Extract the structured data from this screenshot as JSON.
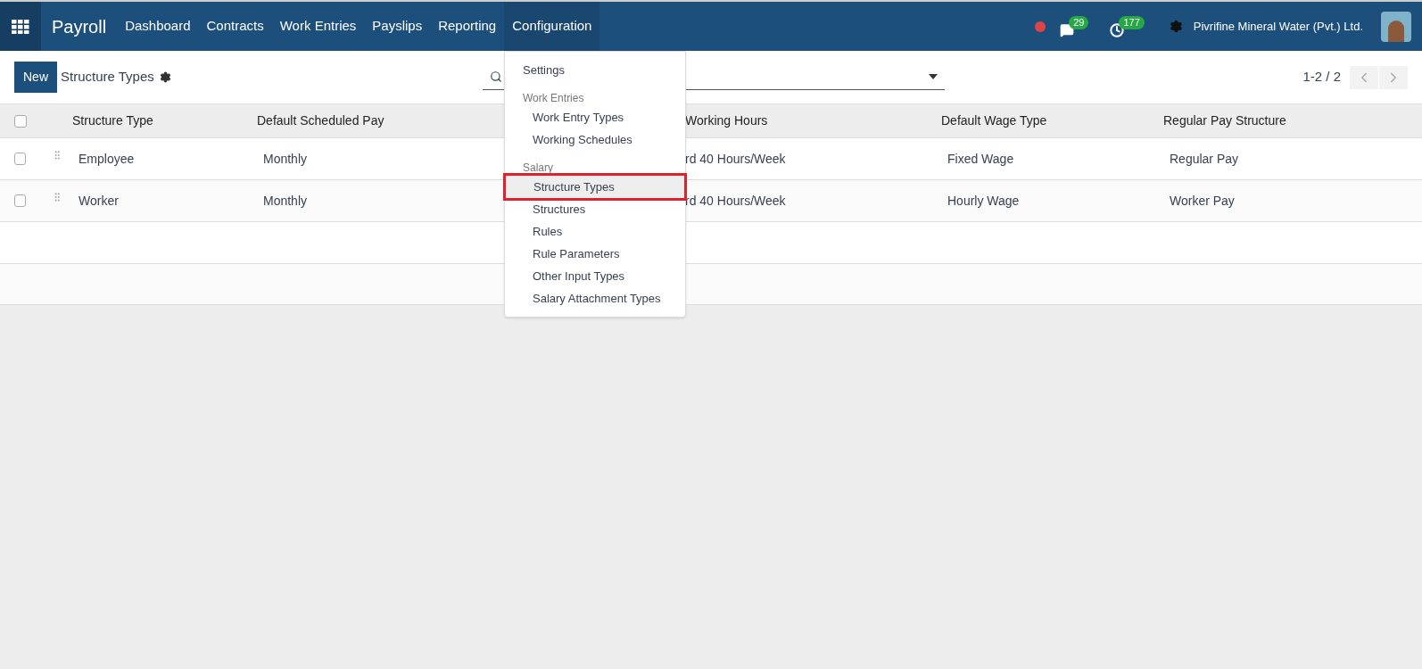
{
  "navbar": {
    "app": "Payroll",
    "menu": [
      {
        "label": "Dashboard",
        "selected": false
      },
      {
        "label": "Contracts",
        "selected": false
      },
      {
        "label": "Work Entries",
        "selected": false
      },
      {
        "label": "Payslips",
        "selected": false
      },
      {
        "label": "Reporting",
        "selected": false
      },
      {
        "label": "Configuration",
        "selected": true
      }
    ],
    "messages_count": "29",
    "activities_count": "177",
    "company": "Pivrifine Mineral Water (Pvt.) Ltd."
  },
  "control_panel": {
    "new_button": "New",
    "breadcrumb": "Structure Types",
    "pager": "1-2 / 2"
  },
  "table": {
    "select_all_checked": false,
    "columns": [
      "Structure Type",
      "Default Scheduled Pay",
      "Working Hours",
      "Default Wage Type",
      "Regular Pay Structure"
    ],
    "rows": [
      {
        "checked": false,
        "cells": [
          "Employee",
          "Monthly",
          "rd 40 Hours/Week",
          "Fixed Wage",
          "Regular Pay"
        ]
      },
      {
        "checked": false,
        "cells": [
          "Worker",
          "Monthly",
          "rd 40 Hours/Week",
          "Hourly Wage",
          "Worker Pay"
        ]
      }
    ]
  },
  "dropdown": {
    "sections": [
      {
        "items": [
          {
            "label": "Settings",
            "selected": false
          }
        ]
      },
      {
        "header": "Work Entries",
        "items": [
          {
            "label": "Work Entry Types",
            "selected": false
          },
          {
            "label": "Working Schedules",
            "selected": false
          }
        ]
      },
      {
        "header": "Salary",
        "items": [
          {
            "label": "Structure Types",
            "selected": true
          },
          {
            "label": "Structures",
            "selected": false
          },
          {
            "label": "Rules",
            "selected": false
          },
          {
            "label": "Rule Parameters",
            "selected": false
          },
          {
            "label": "Other Input Types",
            "selected": false
          },
          {
            "label": "Salary Attachment Types",
            "selected": false
          }
        ]
      }
    ]
  }
}
